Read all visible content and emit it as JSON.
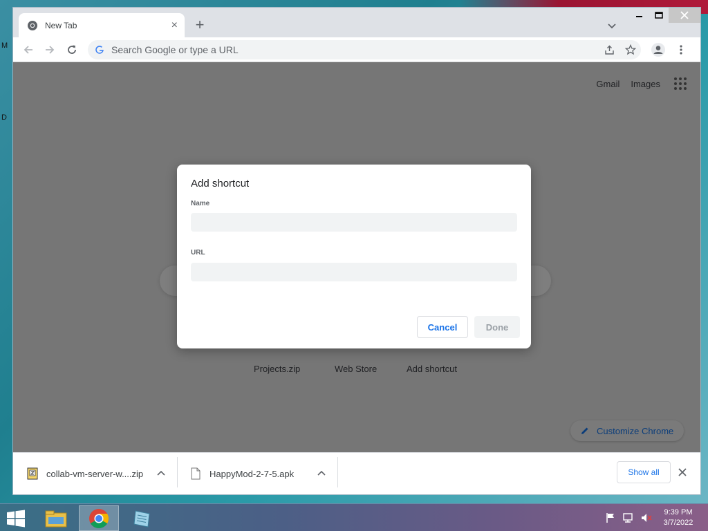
{
  "desktop": {
    "edge_letters": [
      "M",
      "D"
    ]
  },
  "browser": {
    "tab": {
      "title": "New Tab",
      "favicon": "chrome-icon",
      "close_icon": "close-icon"
    },
    "new_tab_icon": "plus-icon",
    "window_controls": [
      "minimize-icon",
      "maximize-icon",
      "close-icon"
    ],
    "toolbar": {
      "back_icon": "arrow-left-icon",
      "forward_icon": "arrow-right-icon",
      "reload_icon": "reload-icon",
      "omnibox_placeholder": "Search Google or type a URL",
      "share_icon": "share-icon",
      "bookmark_icon": "star-icon",
      "profile_icon": "avatar-icon",
      "menu_icon": "more-vert-icon"
    }
  },
  "ntp": {
    "top_links": {
      "gmail": "Gmail",
      "images": "Images"
    },
    "shortcuts": [
      "Projects.zip",
      "Web Store",
      "Add shortcut"
    ],
    "customize_label": "Customize Chrome"
  },
  "dialog": {
    "title": "Add shortcut",
    "name_label": "Name",
    "name_value": "",
    "url_label": "URL",
    "url_value": "",
    "cancel_label": "Cancel",
    "done_label": "Done"
  },
  "downloads": {
    "items": [
      {
        "name": "collab-vm-server-w....zip",
        "icon": "zip-file-icon"
      },
      {
        "name": "HappyMod-2-7-5.apk",
        "icon": "file-icon"
      }
    ],
    "show_all_label": "Show all"
  },
  "taskbar": {
    "clock_time": "9:39 PM",
    "clock_date": "3/7/2022",
    "apps": [
      "file-explorer-icon",
      "chrome-icon",
      "notepad-icon"
    ]
  },
  "colors": {
    "accent_blue": "#1a73e8",
    "overlay_gray": "#767676",
    "chrome_frame": "#dee1e6"
  }
}
